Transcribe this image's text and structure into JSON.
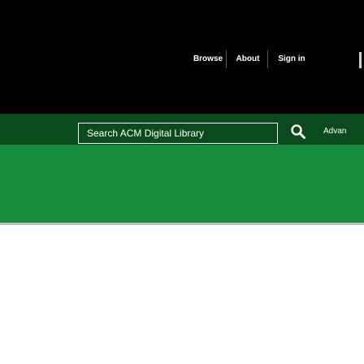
{
  "nav": {
    "items": [
      {
        "label": "Browse"
      },
      {
        "label": "About"
      },
      {
        "label": "Sign in"
      }
    ]
  },
  "search": {
    "placeholder": "Search ACM Digital Library",
    "advanced_label": "Advan"
  },
  "icons": {
    "search_button": "search-icon"
  },
  "colors": {
    "header_bg": "#000000",
    "search_band_bg": "#0b4a1c",
    "green_band_bg": "#168b3c",
    "text": "#ffffff"
  }
}
